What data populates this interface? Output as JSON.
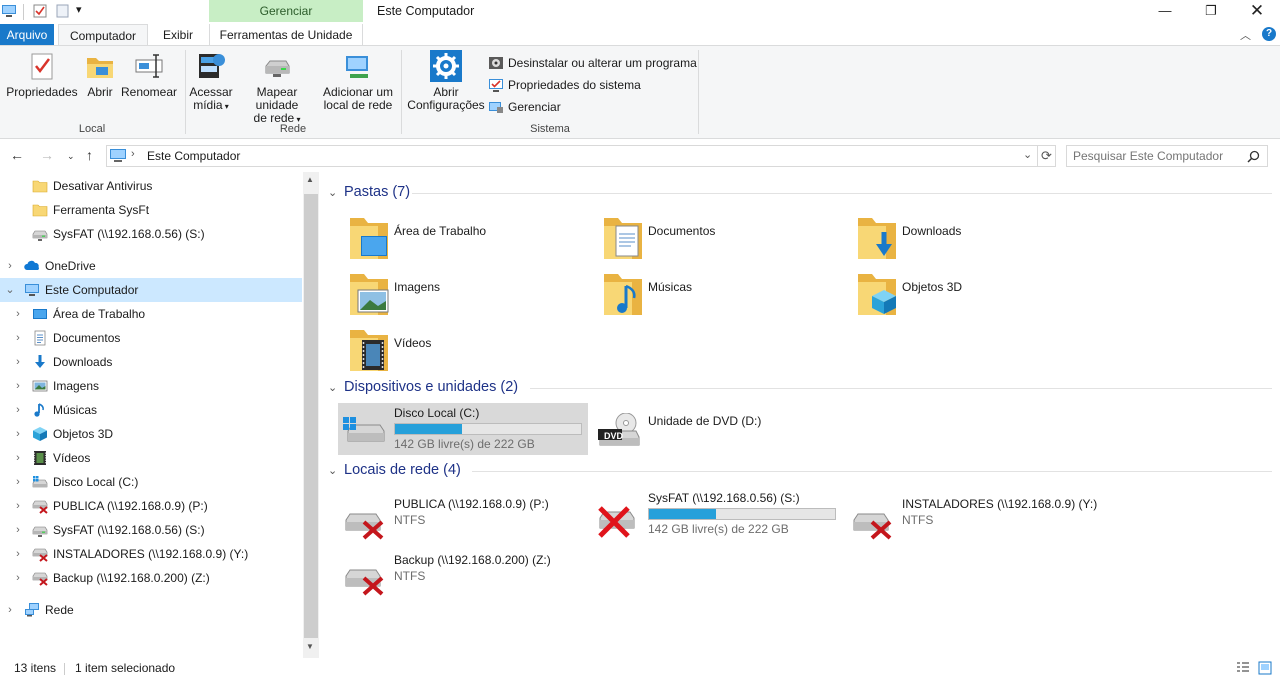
{
  "window": {
    "title": "Este Computador",
    "context_tab": "Gerenciar"
  },
  "tabs": {
    "arquivo": "Arquivo",
    "computador": "Computador",
    "exibir": "Exibir",
    "ferramentas": "Ferramentas de Unidade"
  },
  "ribbon": {
    "local": {
      "label": "Local",
      "propriedades": "Propriedades",
      "abrir": "Abrir",
      "renomear": "Renomear"
    },
    "rede": {
      "label": "Rede",
      "acessar_l1": "Acessar",
      "acessar_l2": "mídia",
      "mapear_l1": "Mapear unidade",
      "mapear_l2": "de rede",
      "adicionar_l1": "Adicionar um",
      "adicionar_l2": "local de rede"
    },
    "sistema": {
      "label": "Sistema",
      "abrir_l1": "Abrir",
      "abrir_l2": "Configurações",
      "desinstalar": "Desinstalar ou alterar um programa",
      "propriedades_sistema": "Propriedades do sistema",
      "gerenciar": "Gerenciar"
    }
  },
  "address": {
    "path": "Este Computador",
    "search_placeholder": "Pesquisar Este Computador"
  },
  "nav": {
    "items": [
      {
        "label": "Desativar Antivirus",
        "icon": "folder-icon"
      },
      {
        "label": "Ferramenta SysFt",
        "icon": "folder-icon"
      },
      {
        "label": "SysFAT (\\\\192.168.0.56) (S:)",
        "icon": "network-drive-icon"
      },
      {
        "label": "OneDrive",
        "icon": "onedrive-icon"
      },
      {
        "label": "Este Computador",
        "icon": "computer-icon"
      },
      {
        "label": "Área de Trabalho",
        "icon": "desktop-icon"
      },
      {
        "label": "Documentos",
        "icon": "documents-icon"
      },
      {
        "label": "Downloads",
        "icon": "downloads-icon"
      },
      {
        "label": "Imagens",
        "icon": "pictures-icon"
      },
      {
        "label": "Músicas",
        "icon": "music-icon"
      },
      {
        "label": "Objetos 3D",
        "icon": "objects3d-icon"
      },
      {
        "label": "Vídeos",
        "icon": "videos-icon"
      },
      {
        "label": "Disco Local (C:)",
        "icon": "local-disk-icon"
      },
      {
        "label": "PUBLICA (\\\\192.168.0.9) (P:)",
        "icon": "disconnected-drive-icon"
      },
      {
        "label": "SysFAT (\\\\192.168.0.56) (S:)",
        "icon": "network-drive-icon"
      },
      {
        "label": "INSTALADORES (\\\\192.168.0.9) (Y:)",
        "icon": "disconnected-drive-icon"
      },
      {
        "label": "Backup (\\\\192.168.0.200) (Z:)",
        "icon": "disconnected-drive-icon"
      },
      {
        "label": "Rede",
        "icon": "network-icon"
      }
    ]
  },
  "content": {
    "folders_header": "Pastas (7)",
    "folders": [
      "Área de Trabalho",
      "Documentos",
      "Downloads",
      "Imagens",
      "Músicas",
      "Objetos 3D",
      "Vídeos"
    ],
    "devices_header": "Dispositivos e unidades (2)",
    "disk_c": {
      "name": "Disco Local (C:)",
      "free": "142 GB livre(s) de 222 GB",
      "used_fraction": 0.36
    },
    "dvd": {
      "name": "Unidade de DVD (D:)",
      "badge": "DVD"
    },
    "network_header": "Locais de rede (4)",
    "network": [
      {
        "name": "PUBLICA (\\\\192.168.0.9) (P:)",
        "fs": "NTFS"
      },
      {
        "name": "SysFAT (\\\\192.168.0.56) (S:)",
        "free": "142 GB livre(s) de 222 GB",
        "used_fraction": 0.36
      },
      {
        "name": "INSTALADORES (\\\\192.168.0.9) (Y:)",
        "fs": "NTFS"
      },
      {
        "name": "Backup (\\\\192.168.0.200) (Z:)",
        "fs": "NTFS"
      }
    ]
  },
  "status": {
    "count": "13 itens",
    "selected": "1 item selecionado"
  },
  "colors": {
    "accent": "#1979ca",
    "folder": "#f8d775",
    "selection": "#cce8ff",
    "bar": "#26a0da",
    "section_header": "#1e3287"
  }
}
